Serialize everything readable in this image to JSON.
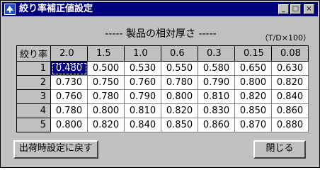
{
  "window": {
    "title": "絞り率補正値設定",
    "minimize": "_",
    "maximize": "□",
    "close": "×"
  },
  "header": {
    "title": "----- 製品の相対厚さ -----",
    "unit": "（T/D×100）"
  },
  "table": {
    "corner": "絞り率",
    "columns": [
      "2.0",
      "1.5",
      "1.0",
      "0.6",
      "0.3",
      "0.15",
      "0.08"
    ],
    "rows": [
      {
        "label": "1",
        "values": [
          "0.480",
          "0.500",
          "0.530",
          "0.550",
          "0.580",
          "0.650",
          "0.630"
        ]
      },
      {
        "label": "2",
        "values": [
          "0.730",
          "0.750",
          "0.760",
          "0.780",
          "0.790",
          "0.800",
          "0.820"
        ]
      },
      {
        "label": "3",
        "values": [
          "0.760",
          "0.780",
          "0.790",
          "0.800",
          "0.810",
          "0.820",
          "0.840"
        ]
      },
      {
        "label": "4",
        "values": [
          "0.780",
          "0.800",
          "0.810",
          "0.820",
          "0.830",
          "0.850",
          "0.860"
        ]
      },
      {
        "label": "5",
        "values": [
          "0.800",
          "0.820",
          "0.840",
          "0.850",
          "0.860",
          "0.870",
          "0.880"
        ]
      }
    ]
  },
  "buttons": {
    "reset": "出荷時設定に戻す",
    "close": "閉じる"
  }
}
